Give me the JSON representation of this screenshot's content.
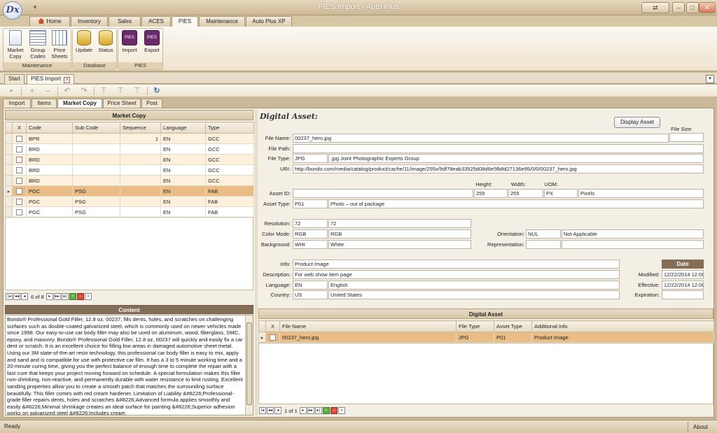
{
  "window": {
    "title": "PIES Import - Auto Plus",
    "logo_text": "Dx",
    "qat_glyph": "▾",
    "controls": [
      "⇄",
      "–",
      "□",
      "✕"
    ]
  },
  "ribbon": {
    "tabs": [
      "Home",
      "Inventory",
      "Sales",
      "ACES",
      "PIES",
      "Maintenance",
      "Auto Plus XP"
    ],
    "active_tab": "PIES",
    "groups": [
      {
        "label": "Maintenance",
        "buttons": [
          [
            "Market",
            "Copy"
          ],
          [
            "Group",
            "Codes"
          ],
          [
            "Price",
            "Sheets"
          ]
        ]
      },
      {
        "label": "Database",
        "buttons": [
          [
            "Update"
          ],
          [
            "Status"
          ]
        ]
      },
      {
        "label": "PIES",
        "buttons": [
          [
            "Import"
          ],
          [
            "Export"
          ]
        ]
      }
    ],
    "pies_icon_text": "PIES"
  },
  "doc_tabs": [
    "Start",
    "PIES Import"
  ],
  "toolbar_icons": [
    "save-icon",
    "add-icon",
    "remove-icon",
    "undo-icon",
    "redo-icon",
    "filter-icon",
    "clear-filter-icon",
    "filter-edit-icon",
    "refresh-icon"
  ],
  "sub_tabs": [
    "Import",
    "Items",
    "Market Copy",
    "Price Sheet",
    "Post"
  ],
  "market_copy": {
    "title": "Market Copy",
    "columns": [
      "X",
      "Code",
      "Sub Code",
      "Sequence",
      "Language",
      "Type"
    ],
    "rows": [
      {
        "code": "BPR",
        "sub": "",
        "seq": "1",
        "lang": "EN",
        "type": "GCC"
      },
      {
        "code": "BRD",
        "sub": "",
        "seq": "",
        "lang": "EN",
        "type": "GCC"
      },
      {
        "code": "BRD",
        "sub": "",
        "seq": "",
        "lang": "EN",
        "type": "GCC"
      },
      {
        "code": "BRD",
        "sub": "",
        "seq": "",
        "lang": "EN",
        "type": "GCC"
      },
      {
        "code": "BRD",
        "sub": "",
        "seq": "",
        "lang": "EN",
        "type": "GCC"
      },
      {
        "code": "PGC",
        "sub": "PSG",
        "seq": "",
        "lang": "EN",
        "type": "FAB"
      },
      {
        "code": "PGC",
        "sub": "PSG",
        "seq": "",
        "lang": "EN",
        "type": "FAB"
      },
      {
        "code": "PGC",
        "sub": "PSG",
        "seq": "",
        "lang": "EN",
        "type": "FAB"
      }
    ],
    "selected_row": 5,
    "pager": "6 of 8"
  },
  "content": {
    "title": "Content",
    "text": "Bondo® Professional Gold Filler, 12.8 oz, 00237, fills dents, holes, and scratches on challenging surfaces such as double-coated galvanized steel, which is commonly used on newer vehicles made since 1998. Our easy-to-use car body filler may also be used on aluminum, wood, fiberglass, SMC, epoxy, and masonry. Bondo® Professional Gold Filler, 12.8 oz, 00237 will quickly and easily fix a car dent or scratch. It is an excellent choice for filling low areas in damaged automotive sheet metal. Using our 3M state-of-the-art resin technology, this professional car body filler is easy to mix, apply and sand and is compatible for use with protective car film. It has a 3 to 5 minute working time and a 20-minute curing time, giving you the perfect balance of enough time to complete the repair with a fast cure that keeps your project moving forward on schedule. A special formulation makes this filler non-shrinking, non-reactive, and permanently durable with water resistance to limit rusting. Excellent sanding properties allow you to create a smooth patch that matches the surrounding surface beautifully. This filler comes with red cream hardener. Limitation of Liability &#8226;Professional-grade filler repairs dents, holes and scratches &#8226;Advanced formula applies smoothly and easily &#8226;Minimal shrinkage creates an ideal surface for painting &#8226;Superior adhesion works on galvanized steel &#8226;Includes cream"
  },
  "digital_asset_form": {
    "title": "Digital Asset:",
    "display_button": "Display Asset",
    "labels": {
      "file_name": "File Name:",
      "file_path": "File Path:",
      "file_type": "File Type:",
      "uri": "URI:",
      "file_size": "File Size:",
      "height": "Height:",
      "width": "Width:",
      "uom": "UOM:",
      "asset_id": "Asset ID:",
      "asset_type": "Asset Type:",
      "resolution": "Resolution:",
      "color_mode": "Color Mode:",
      "background": "Background:",
      "orientation": "Orientation:",
      "representation": "Representation:",
      "info": "Info:",
      "description": "Description:",
      "language": "Language:",
      "country": "Country:",
      "date": "Date",
      "modified": "Modified:",
      "effective": "Effective:",
      "expiration": "Expiration:"
    },
    "values": {
      "file_name": "00237_hero.jpg",
      "file_path": "",
      "file_size": "",
      "file_type_code": "JPG",
      "file_type_desc": ".jpg Joint Photographic Experts Group",
      "uri": "http://bondo.com/media/catalog/product/cache/11/image/255x/9df78eab33525d08d6e5fb8d27136e95/0/0/00237_hero.jpg",
      "asset_id": "",
      "height": "255",
      "width": "255",
      "uom_code": "PX",
      "uom_desc": "Pixels",
      "asset_type_code": "P01",
      "asset_type_desc": "Photo – out of package",
      "resolution_1": "72",
      "resolution_2": "72",
      "color_mode_code": "RGB",
      "color_mode_desc": "RGB",
      "background_code": "WHI",
      "background_desc": "White",
      "orientation_code": "NUL",
      "orientation_desc": "Not Applicable",
      "representation_code": "",
      "representation_desc": "",
      "info": "Product Image",
      "description": "For web show item page",
      "language_code": "EN",
      "language_desc": "English",
      "country_code": "US",
      "country_desc": "United States",
      "modified": "12/22/2014 12:00",
      "effective": "12/22/2014 12:00",
      "expiration": ""
    }
  },
  "digital_asset_grid": {
    "title": "Digital Asset",
    "columns": [
      "X",
      "File Name",
      "File Type",
      "Asset Type",
      "Additional Info"
    ],
    "rows": [
      {
        "file": "00237_hero.jpg",
        "type": "JPG",
        "asset": "P01",
        "info": "Product Image"
      }
    ],
    "pager": "1 of 1"
  },
  "status": {
    "text": "Ready",
    "about": "About"
  }
}
